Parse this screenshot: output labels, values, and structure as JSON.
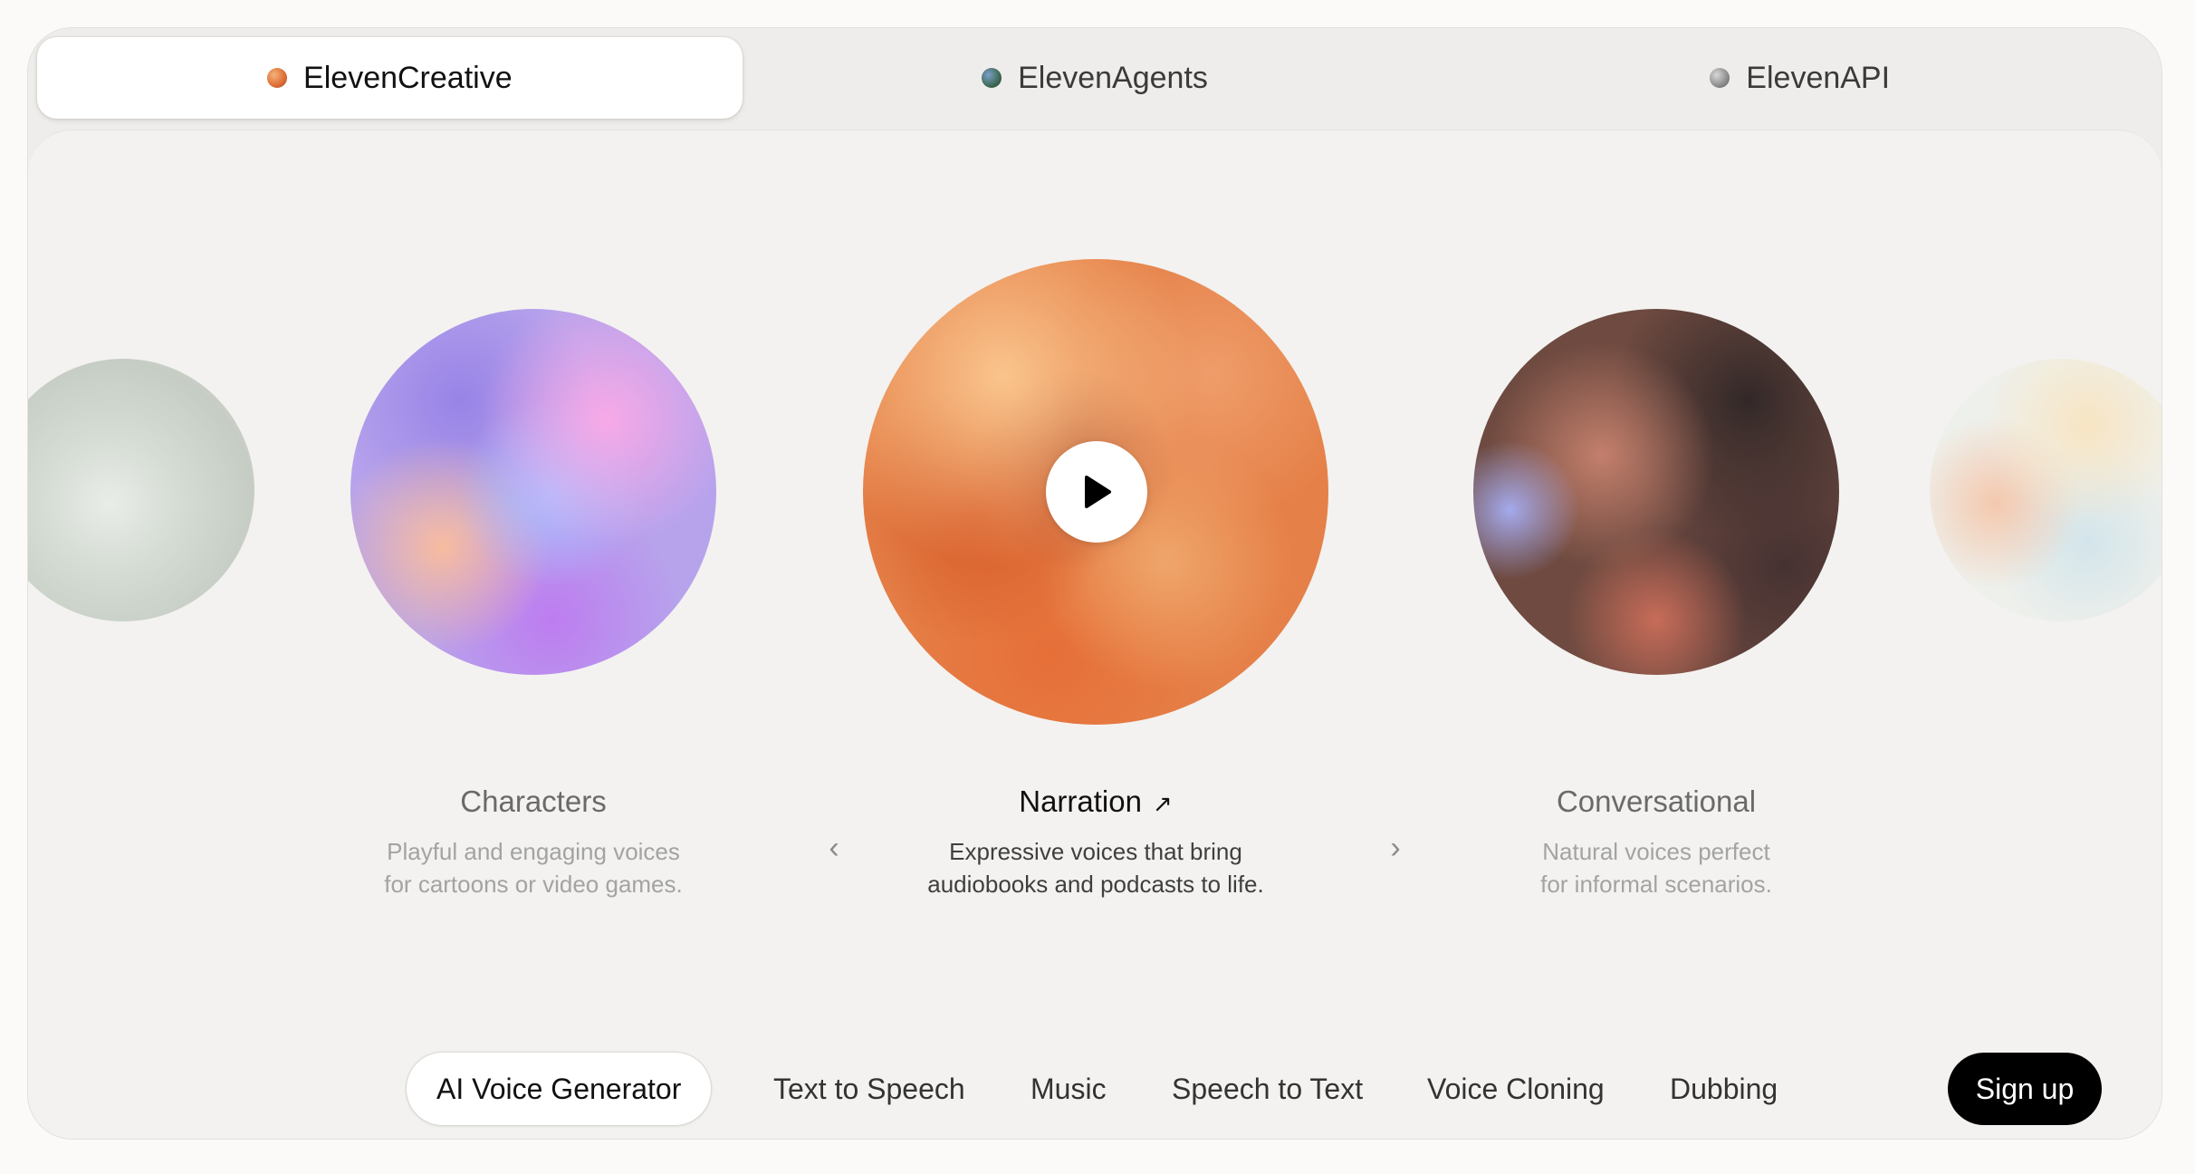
{
  "top_tabs": [
    {
      "label": "ElevenCreative",
      "active": true,
      "icon": "orange-orb-dot"
    },
    {
      "label": "ElevenAgents",
      "active": false,
      "icon": "green-blue-orb-dot"
    },
    {
      "label": "ElevenAPI",
      "active": false,
      "icon": "gray-orb-dot"
    }
  ],
  "carousel": {
    "items": [
      {
        "title": "Characters",
        "description_line1": "Playful and engaging voices",
        "description_line2": "for cartoons or video games."
      },
      {
        "title": "Narration",
        "description_line1": "Expressive voices that bring",
        "description_line2": "audiobooks and podcasts to life.",
        "active": true,
        "link_icon": "↗"
      },
      {
        "title": "Conversational",
        "description_line1": "Natural voices perfect",
        "description_line2": "for informal scenarios."
      }
    ],
    "prev_icon": "‹",
    "next_icon": "›"
  },
  "product_nav": {
    "items": [
      "AI Voice Generator",
      "Text to Speech",
      "Music",
      "Speech to Text",
      "Voice Cloning",
      "Dubbing"
    ],
    "active_index": 0,
    "signup_label": "Sign up"
  },
  "colors": {
    "page_bg": "#fbfaf9",
    "card_bg": "#efedeb",
    "panel_bg": "#f3f2f0",
    "signup_bg": "#000000"
  }
}
